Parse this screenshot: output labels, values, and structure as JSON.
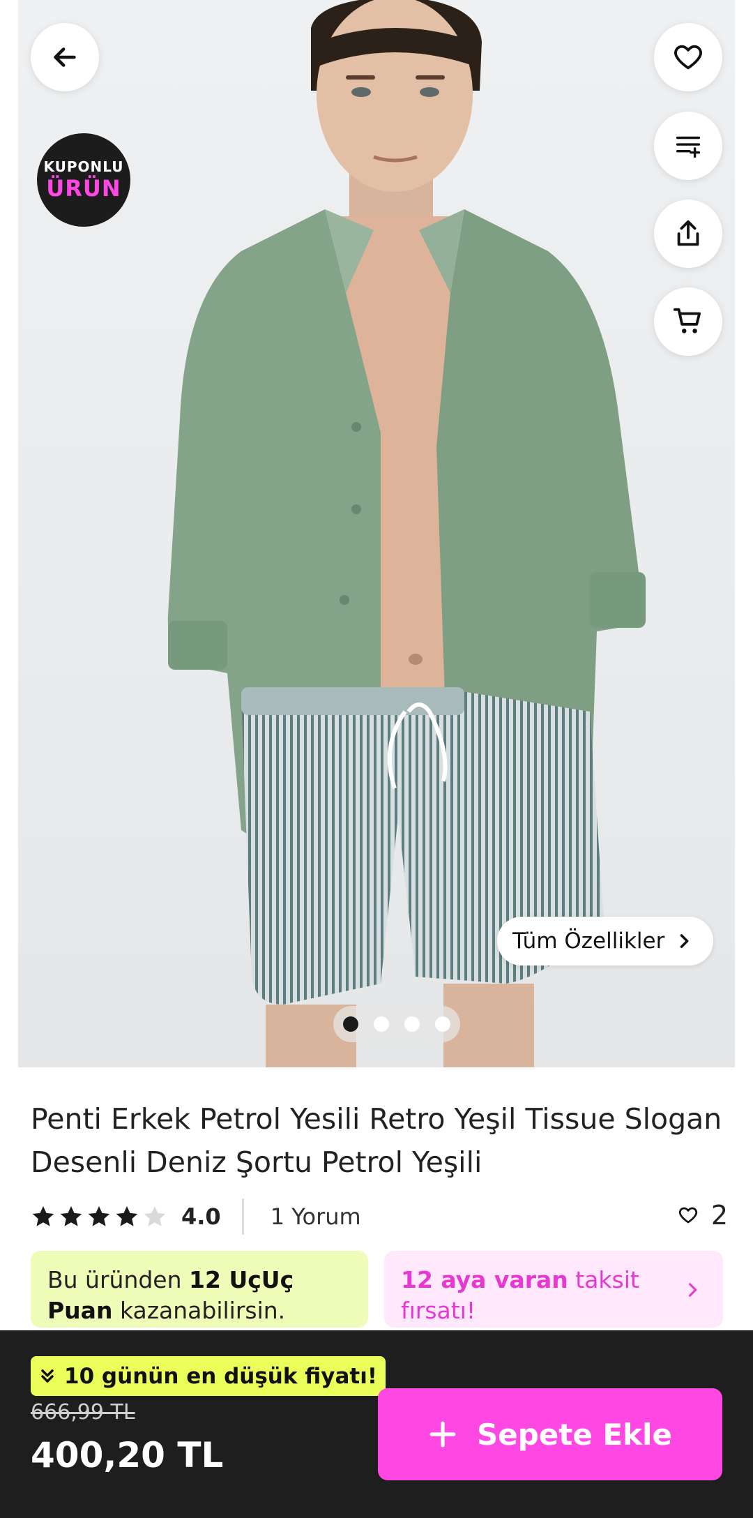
{
  "colors": {
    "brand_pink": "#ff47e4",
    "lime": "#eaff5a",
    "points_card_bg": "#eefcb8",
    "installment_card_bg": "#ffe8fb",
    "bottom_bar_bg": "#1e1e1e"
  },
  "top_actions": {
    "back_icon": "arrow-left-icon",
    "favorite_icon": "heart-icon",
    "compare_icon": "list-add-icon",
    "share_icon": "share-icon",
    "cart_icon": "cart-icon"
  },
  "badge": {
    "line1": "KUPONLU",
    "line2": "ÜRÜN"
  },
  "gallery": {
    "all_features_label": "Tüm Özellikler",
    "image_count": 4,
    "active_index": 0
  },
  "product": {
    "title": "Penti Erkek Petrol Yesili Retro Yeşil Tissue Slogan Desenli Deniz Şortu Petrol Yeşili",
    "rating": "4.0",
    "rating_stars": 4,
    "reviews_label": "1 Yorum",
    "favorite_count": "2"
  },
  "points_card": {
    "prefix": "Bu üründen",
    "highlight": "12 UçUç Puan",
    "suffix": "kazanabilirsin."
  },
  "installment_card": {
    "highlight": "12 aya varan",
    "suffix": "taksit fırsatı!"
  },
  "bottom_bar": {
    "lowest_price_label": "10 günün en düşük fiyatı!",
    "old_price": "666,99 TL",
    "price": "400,20 TL",
    "add_to_cart_label": "Sepete Ekle"
  }
}
